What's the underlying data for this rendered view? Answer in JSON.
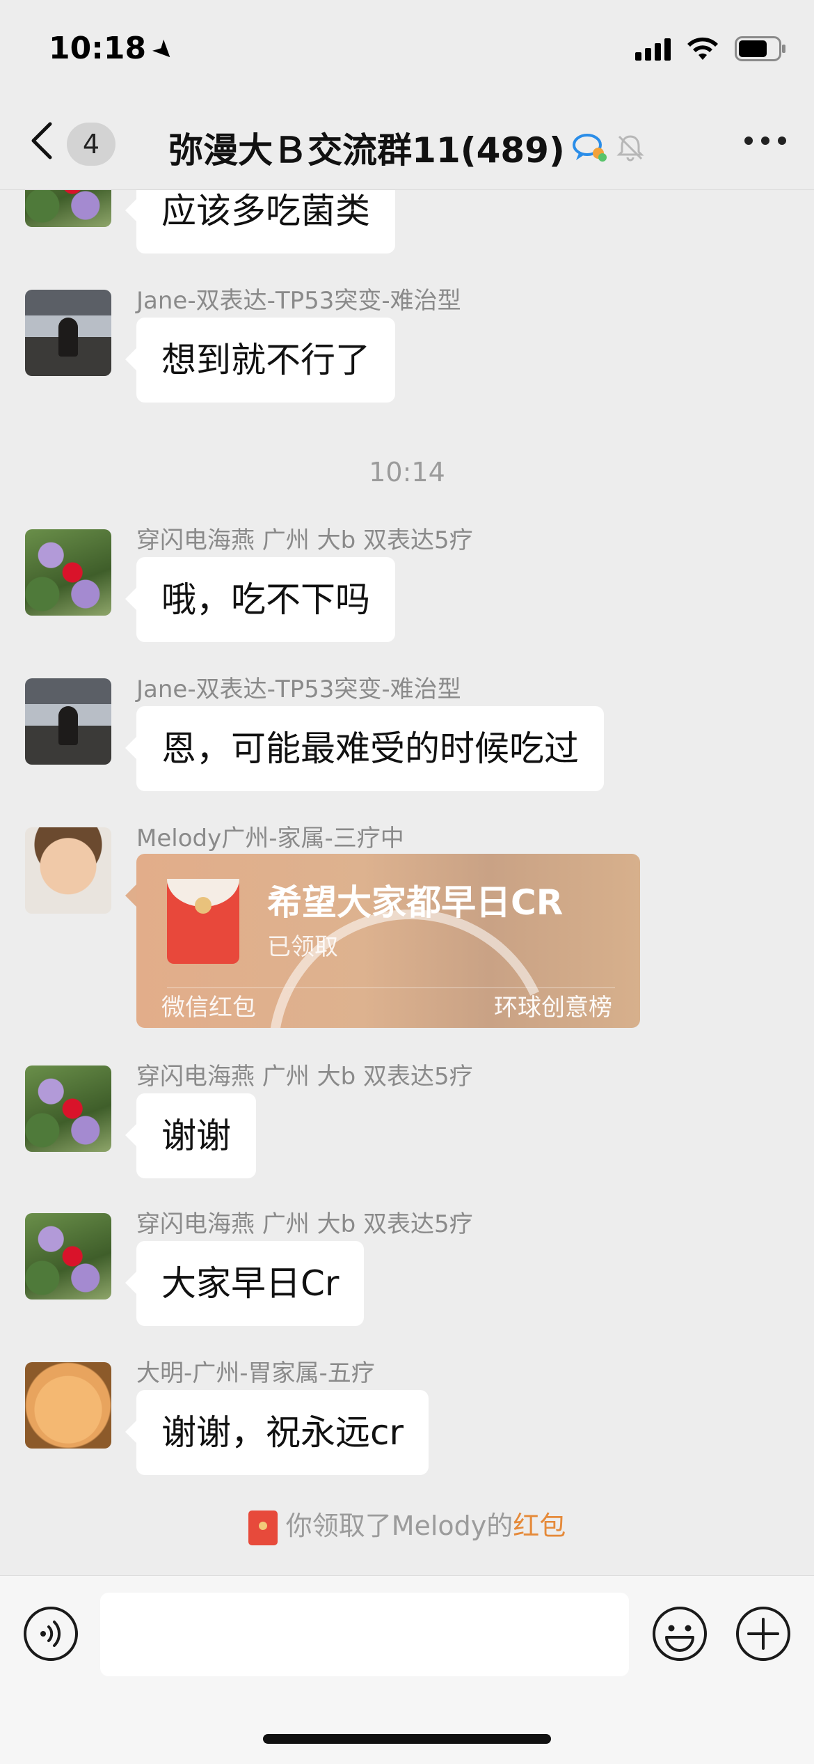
{
  "status_bar": {
    "time": "10:18"
  },
  "nav": {
    "back_count": "4",
    "title": "弥漫大Ｂ交流群11(489)"
  },
  "messages": [
    {
      "sender": "",
      "text": "应该多吃菌类"
    },
    {
      "sender": "Jane-双表达-TP53突变-难治型",
      "text": "想到就不行了"
    },
    {
      "sender": "穿闪电海燕 广州 大b 双表达5疗",
      "text": "哦，吃不下吗"
    },
    {
      "sender": "Jane-双表达-TP53突变-难治型",
      "text": "恩，可能最难受的时候吃过"
    },
    {
      "sender": "Melody广州-家属-三疗中",
      "text": ""
    },
    {
      "sender": "穿闪电海燕 广州 大b 双表达5疗",
      "text": "谢谢"
    },
    {
      "sender": "穿闪电海燕 广州 大b 双表达5疗",
      "text": "大家早日Cr"
    },
    {
      "sender": "大明-广州-胃家属-五疗",
      "text": "谢谢，祝永远cr"
    }
  ],
  "timestamp": "10:14",
  "red_packet": {
    "title": "希望大家都早日CR",
    "status": "已领取",
    "footer_left": "微信红包",
    "footer_right": "环球创意榜"
  },
  "system_note": {
    "prefix": "你领取了Melody的",
    "link": "红包"
  },
  "input": {
    "value": "",
    "placeholder": ""
  },
  "icons": {
    "back": "chevron-left-icon",
    "more": "more-dots-icon",
    "voice": "voice-icon",
    "emoji": "emoji-icon",
    "plus": "plus-icon"
  },
  "colors": {
    "background": "#ededed",
    "bubble": "#ffffff",
    "link": "#e58a3a",
    "packet": "#e2ad8a"
  }
}
